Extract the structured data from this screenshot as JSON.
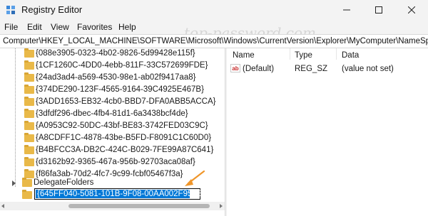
{
  "window": {
    "title": "Registry Editor",
    "watermark": "top-password.com"
  },
  "menu": [
    "File",
    "Edit",
    "View",
    "Favorites",
    "Help"
  ],
  "address": "Computer\\HKEY_LOCAL_MACHINE\\SOFTWARE\\Microsoft\\Windows\\CurrentVersion\\Explorer\\MyComputer\\NameSpace\\",
  "tree": {
    "items": [
      "{088e3905-0323-4b02-9826-5d99428e115f}",
      "{1CF1260C-4DD0-4ebb-811F-33C572699FDE}",
      "{24ad3ad4-a569-4530-98e1-ab02f9417aa8}",
      "{374DE290-123F-4565-9164-39C4925E467B}",
      "{3ADD1653-EB32-4cb0-BBD7-DFA0ABB5ACCA}",
      "{3dfdf296-dbec-4fb4-81d1-6a3438bcf4de}",
      "{A0953C92-50DC-43bf-BE83-3742FED03C9C}",
      "{A8CDFF1C-4878-43be-B5FD-F8091C1C60D0}",
      "{B4BFCC3A-DB2C-424C-B029-7FE99A87C641}",
      "{d3162b92-9365-467a-956b-92703aca08af}",
      "{f86fa3ab-70d2-4fc7-9c99-fcbf05467f3a}"
    ],
    "parent_label": "DelegateFolders",
    "edit_value": "{645FF040-5081-101B-9F08-00AA002F954E}"
  },
  "list": {
    "columns": [
      "Name",
      "Type",
      "Data"
    ],
    "rows": [
      {
        "name": "(Default)",
        "type": "REG_SZ",
        "data": "(value not set)",
        "icon": "ab-string-icon"
      }
    ]
  },
  "colors": {
    "selection": "#0078d7",
    "folder": "#e9b949",
    "arrow": "#f0962a"
  }
}
